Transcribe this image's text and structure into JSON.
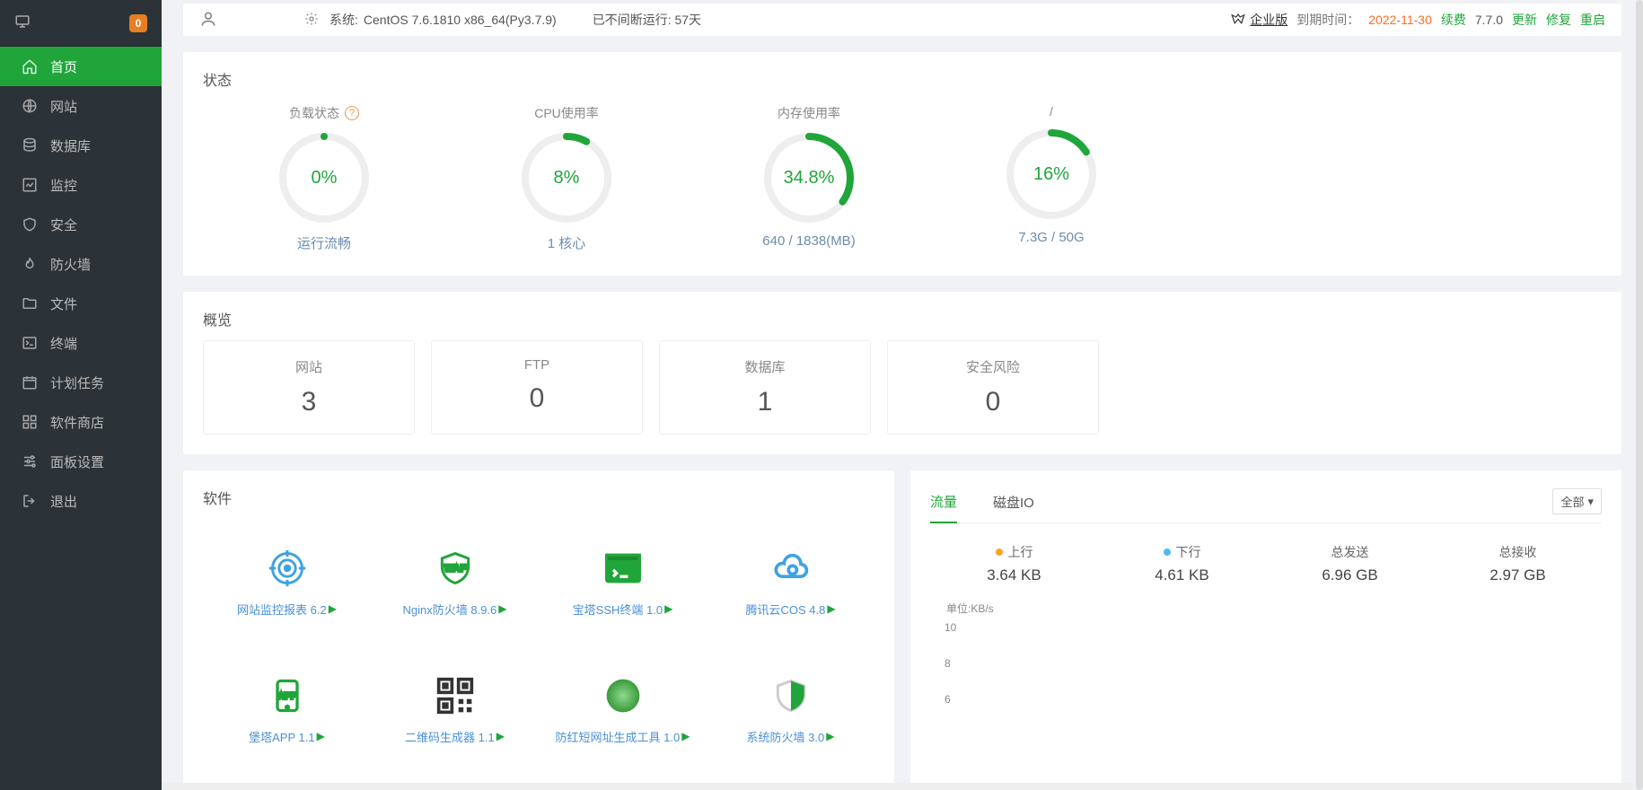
{
  "sidebar": {
    "badge": "0",
    "items": [
      {
        "label": "首页"
      },
      {
        "label": "网站"
      },
      {
        "label": "数据库"
      },
      {
        "label": "监控"
      },
      {
        "label": "安全"
      },
      {
        "label": "防火墙"
      },
      {
        "label": "文件"
      },
      {
        "label": "终端"
      },
      {
        "label": "计划任务"
      },
      {
        "label": "软件商店"
      },
      {
        "label": "面板设置"
      },
      {
        "label": "退出"
      }
    ]
  },
  "topbar": {
    "sys_lbl": "系统:",
    "sys_val": "CentOS 7.6.1810 x86_64(Py3.7.9)",
    "running": "已不间断运行: 57天",
    "ent_badge": "企业版",
    "expire_lbl": "到期时间：",
    "expire_date": "2022-11-30",
    "renew": "续费",
    "version": "7.7.0",
    "update": "更新",
    "repair": "修复",
    "restart": "重启"
  },
  "status": {
    "title": "状态",
    "gauges": [
      {
        "title": "负载状态",
        "pct": "0%",
        "sub": "运行流畅",
        "arc": 0,
        "help": true
      },
      {
        "title": "CPU使用率",
        "pct": "8%",
        "sub": "1 核心",
        "arc": 8
      },
      {
        "title": "内存使用率",
        "pct": "34.8%",
        "sub": "640 / 1838(MB)",
        "arc": 34.8
      },
      {
        "title": "/",
        "pct": "16%",
        "sub": "7.3G / 50G",
        "arc": 16
      }
    ]
  },
  "overview": {
    "title": "概览",
    "cards": [
      {
        "label": "网站",
        "value": "3"
      },
      {
        "label": "FTP",
        "value": "0"
      },
      {
        "label": "数据库",
        "value": "1"
      },
      {
        "label": "安全风险",
        "value": "0"
      }
    ]
  },
  "software": {
    "title": "软件",
    "items": [
      {
        "name": "网站监控报表 6.2",
        "icon": "target"
      },
      {
        "name": "Nginx防火墙 8.9.6",
        "icon": "waf"
      },
      {
        "name": "宝塔SSH终端 1.0",
        "icon": "terminal"
      },
      {
        "name": "腾讯云COS 4.8",
        "icon": "cloud"
      },
      {
        "name": "堡塔APP 1.1",
        "icon": "app"
      },
      {
        "name": "二维码生成器 1.1",
        "icon": "qr"
      },
      {
        "name": "防红短网址生成工具 1.0",
        "icon": "orb"
      },
      {
        "name": "系统防火墙 3.0",
        "icon": "shield"
      }
    ]
  },
  "traffic": {
    "tab_traffic": "流量",
    "tab_disk": "磁盘IO",
    "all": "全部",
    "stats": [
      {
        "label": "上行",
        "value": "3.64 KB",
        "dot": "up"
      },
      {
        "label": "下行",
        "value": "4.61 KB",
        "dot": "dn"
      },
      {
        "label": "总发送",
        "value": "6.96 GB"
      },
      {
        "label": "总接收",
        "value": "2.97 GB"
      }
    ],
    "unit": "单位:KB/s",
    "y": [
      "10",
      "8",
      "6"
    ]
  },
  "chart_data": {
    "type": "line",
    "title": "流量",
    "ylabel": "KB/s",
    "ylim": [
      0,
      10
    ],
    "series": [
      {
        "name": "上行",
        "values": []
      },
      {
        "name": "下行",
        "values": []
      }
    ]
  }
}
